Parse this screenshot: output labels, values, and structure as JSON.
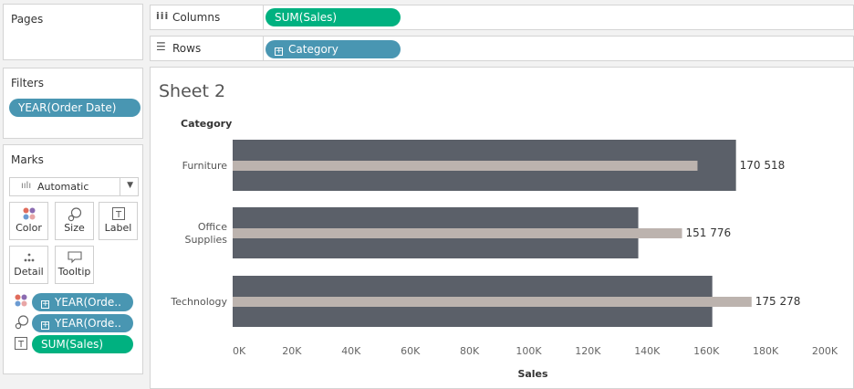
{
  "pages_panel": {
    "title": "Pages"
  },
  "filters_panel": {
    "title": "Filters",
    "pill": "YEAR(Order Date)"
  },
  "marks_panel": {
    "title": "Marks",
    "mark_type": "Automatic",
    "buttons": {
      "color": "Color",
      "size": "Size",
      "label": "Label",
      "detail": "Detail",
      "tooltip": "Tooltip"
    },
    "fields": [
      "YEAR(Orde..",
      "YEAR(Orde..",
      "SUM(Sales)"
    ]
  },
  "shelves": {
    "columns_label": "Columns",
    "columns_pill": "SUM(Sales)",
    "rows_label": "Rows",
    "rows_pill": "Category"
  },
  "sheet": {
    "title": "Sheet 2",
    "row_header": "Category"
  },
  "colors": {
    "wide_bar": "#5b6069",
    "narrow_bar": "#bcb3ae",
    "pill_blue": "#4996b2",
    "pill_green": "#00b180"
  },
  "chart_data": {
    "type": "bar",
    "orientation": "horizontal",
    "categories": [
      "Furniture",
      "Office Supplies",
      "Technology"
    ],
    "category_label_lines": [
      [
        "Furniture"
      ],
      [
        "Office",
        "Supplies"
      ],
      [
        "Technology"
      ]
    ],
    "series": [
      {
        "values": [
          170000,
          137000,
          162000
        ]
      },
      {
        "values": [
          157000,
          151776,
          175278
        ]
      }
    ],
    "data_labels": [
      "170 518",
      "151 776",
      "175 278"
    ],
    "xlabel": "Sales",
    "ylabel": "Category",
    "xlim": [
      0,
      200000
    ],
    "ticks": [
      0,
      20000,
      40000,
      60000,
      80000,
      100000,
      120000,
      140000,
      160000,
      180000,
      200000
    ],
    "tick_labels": [
      "0K",
      "20K",
      "40K",
      "60K",
      "80K",
      "100K",
      "120K",
      "140K",
      "160K",
      "180K",
      "200K"
    ],
    "grid": false
  }
}
